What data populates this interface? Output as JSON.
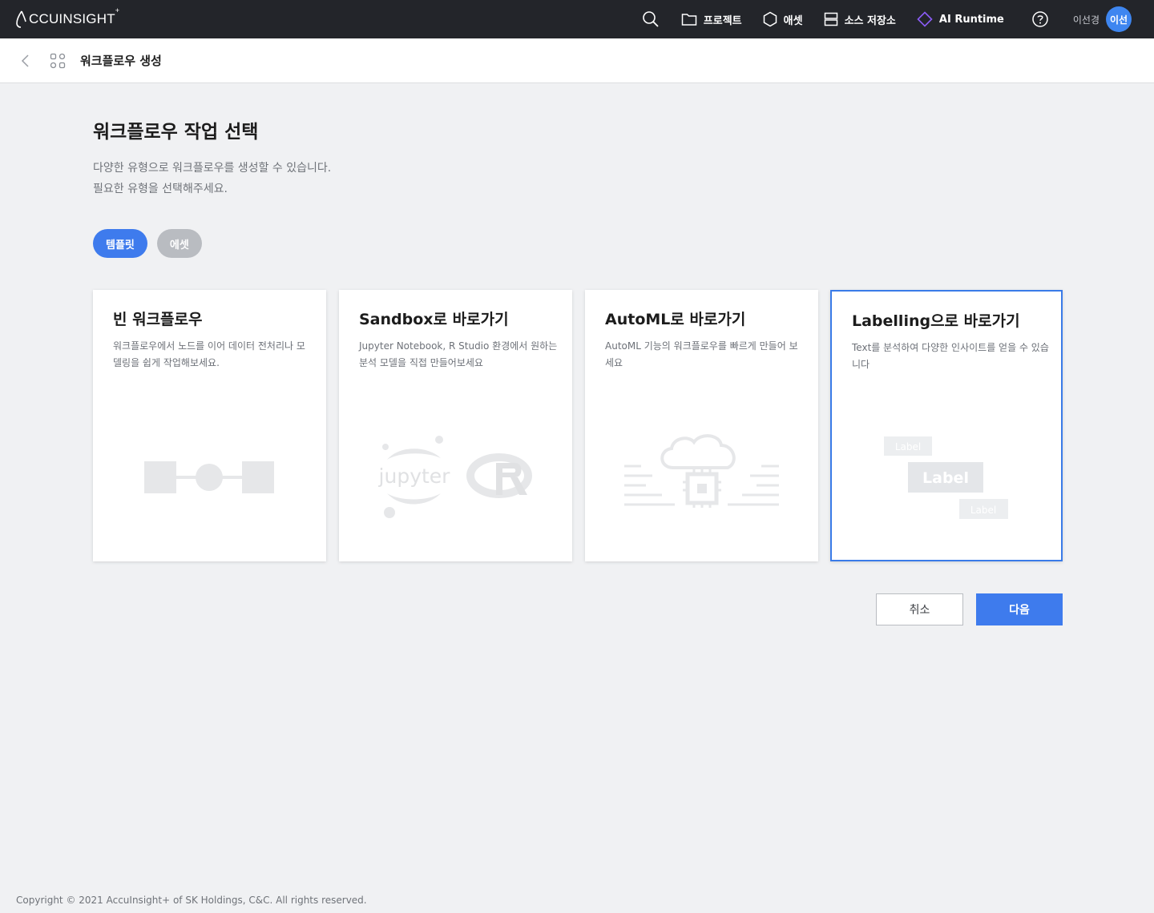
{
  "brand": {
    "logo_text": "CCUINSIGHT",
    "logo_sup": "+"
  },
  "nav": {
    "items": [
      {
        "label": "프로젝트",
        "icon": "folder-icon"
      },
      {
        "label": "애셋",
        "icon": "hexagon-icon"
      },
      {
        "label": "소스 저장소",
        "icon": "storage-icon"
      },
      {
        "label": "AI Runtime",
        "icon": "diamond-icon",
        "accent": "#8b5cf6"
      }
    ],
    "user_name": "이선경",
    "avatar_initials": "이선"
  },
  "subheader": {
    "title": "워크플로우 생성"
  },
  "main": {
    "title": "워크플로우 작업 선택",
    "desc_line1": "다양한 유형으로 워크플로우를 생성할 수 있습니다.",
    "desc_line2": "필요한 유형을 선택해주세요.",
    "tabs": [
      {
        "label": "템플릿",
        "active": true
      },
      {
        "label": "에셋",
        "active": false
      }
    ]
  },
  "cards": [
    {
      "title": "빈 워크플로우",
      "desc": "워크플로우에서 노드를 이어 데이터 전처리나 모델링을 쉽게 작업해보세요.",
      "selected": false
    },
    {
      "title": "Sandbox로 바로가기",
      "desc": "Jupyter Notebook, R Studio 환경에서 원하는 분석 모델을 직접 만들어보세요",
      "selected": false,
      "illu_text": "jupyter"
    },
    {
      "title": "AutoML로 바로가기",
      "desc": "AutoML 기능의 워크플로우를 빠르게 만들어 보세요",
      "selected": false
    },
    {
      "title": "Labelling으로 바로가기",
      "desc": "Text를 분석하여 다양한 인사이트를 얻을 수 있습니다",
      "selected": true,
      "illu_labels": [
        "Label",
        "Label",
        "Label"
      ]
    }
  ],
  "actions": {
    "cancel": "취소",
    "next": "다음"
  },
  "footer": "Copyright © 2021 AccuInsight+ of SK Holdings, C&C. All rights reserved.",
  "colors": {
    "primary": "#3e7bed",
    "nav_bg": "#23252a",
    "page_bg": "#f0f1f3"
  }
}
